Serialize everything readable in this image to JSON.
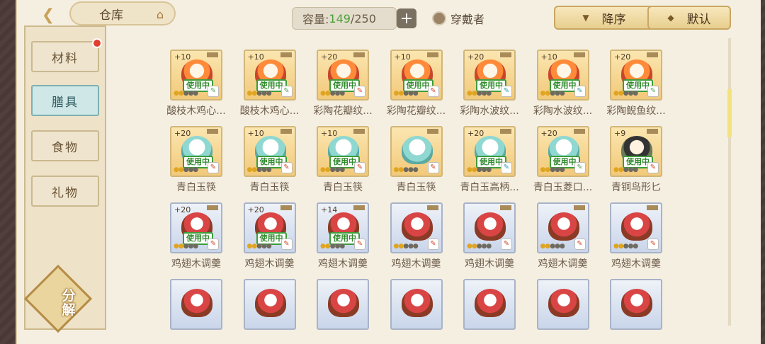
{
  "header": {
    "title": "仓库",
    "capacity_label": "容量:",
    "capacity_used": "149",
    "capacity_total": "/250",
    "add_label": "+",
    "wearer_label": "穿戴者",
    "sort_label": "降序",
    "default_label": "默认"
  },
  "sidebar": {
    "items": [
      {
        "label": "材料"
      },
      {
        "label": "膳具"
      },
      {
        "label": "食物"
      },
      {
        "label": "礼物"
      }
    ],
    "decompose_1": "分",
    "decompose_2": "解"
  },
  "inventory": {
    "in_use_label": "使用中",
    "rows": [
      [
        {
          "level": "+10",
          "name": "酸枝木鸡心...",
          "in_use": true
        },
        {
          "level": "+10",
          "name": "酸枝木鸡心...",
          "in_use": true
        },
        {
          "level": "+20",
          "name": "彩陶花瓣纹...",
          "in_use": true
        },
        {
          "level": "+10",
          "name": "彩陶花瓣纹...",
          "in_use": true
        },
        {
          "level": "+20",
          "name": "彩陶水波纹...",
          "in_use": true
        },
        {
          "level": "+10",
          "name": "彩陶水波纹...",
          "in_use": true
        },
        {
          "level": "+20",
          "name": "彩陶鲵鱼纹...",
          "in_use": true
        }
      ],
      [
        {
          "level": "+20",
          "name": "青白玉筷",
          "in_use": true
        },
        {
          "level": "+10",
          "name": "青白玉筷",
          "in_use": true
        },
        {
          "level": "+10",
          "name": "青白玉筷",
          "in_use": true
        },
        {
          "level": "",
          "name": "青白玉筷",
          "in_use": false
        },
        {
          "level": "+20",
          "name": "青白玉高柄...",
          "in_use": true
        },
        {
          "level": "+20",
          "name": "青白玉菱口...",
          "in_use": true
        },
        {
          "level": "+9",
          "name": "青铜鸟形匕",
          "in_use": true
        }
      ],
      [
        {
          "level": "+20",
          "name": "鸡翅木调羹",
          "in_use": true
        },
        {
          "level": "+20",
          "name": "鸡翅木调羹",
          "in_use": true
        },
        {
          "level": "+14",
          "name": "鸡翅木调羹",
          "in_use": true
        },
        {
          "level": "",
          "name": "鸡翅木调羹",
          "in_use": false
        },
        {
          "level": "",
          "name": "鸡翅木调羹",
          "in_use": false
        },
        {
          "level": "",
          "name": "鸡翅木调羹",
          "in_use": false
        },
        {
          "level": "",
          "name": "鸡翅木调羹",
          "in_use": false
        }
      ]
    ]
  }
}
